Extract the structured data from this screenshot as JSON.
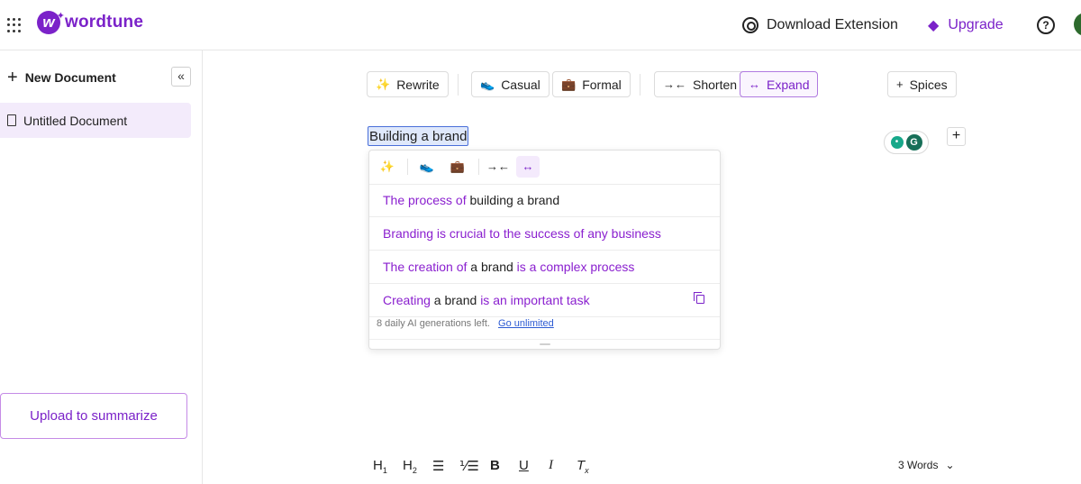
{
  "header": {
    "logo_text": "wordtune",
    "logo_letter": "w",
    "download_label": "Download Extension",
    "upgrade_label": "Upgrade",
    "help_glyph": "?"
  },
  "sidebar": {
    "new_document_label": "New Document",
    "collapse_glyph": "«",
    "documents": [
      {
        "title": "Untitled Document",
        "active": true
      }
    ],
    "upload_label": "Upload to summarize"
  },
  "toolbar": {
    "rewrite": "Rewrite",
    "casual": "Casual",
    "formal": "Formal",
    "shorten": "Shorten",
    "expand": "Expand",
    "spices": "Spices",
    "active_tool": "expand"
  },
  "editor": {
    "selected_text": "Building a brand"
  },
  "popup": {
    "suggestions": [
      [
        {
          "t": "The process of ",
          "c": "p"
        },
        {
          "t": "building a brand",
          "c": "k"
        }
      ],
      [
        {
          "t": "Branding is crucial to the success of any business",
          "c": "p"
        }
      ],
      [
        {
          "t": "The creation of ",
          "c": "p"
        },
        {
          "t": "a brand",
          "c": "k"
        },
        {
          "t": " is a complex process",
          "c": "p"
        }
      ],
      [
        {
          "t": "Creating",
          "c": "p"
        },
        {
          "t": " a brand ",
          "c": "k"
        },
        {
          "t": "is an important task",
          "c": "p"
        }
      ]
    ],
    "footer_text": "8 daily AI generations left.",
    "footer_link": "Go unlimited"
  },
  "format_bar": {
    "h1": "H1",
    "h2": "H2",
    "bold": "B",
    "underline": "U",
    "italic": "I",
    "clear": "Tx",
    "word_count": "3 Words"
  },
  "colors": {
    "brand": "#7b22c9",
    "suggestion_purple": "#8a1fcf",
    "active_bg": "#f3ebfb",
    "selection_border": "#4a6fd9"
  },
  "icons": [
    "apps-grid-icon",
    "chrome-icon",
    "gem-icon",
    "help-icon",
    "plus-icon",
    "chevrons-left-icon",
    "file-icon",
    "sparkle-icon",
    "sneaker-icon",
    "briefcase-icon",
    "compress-icon",
    "expand-icon",
    "copy-icon",
    "chevron-down-icon"
  ]
}
